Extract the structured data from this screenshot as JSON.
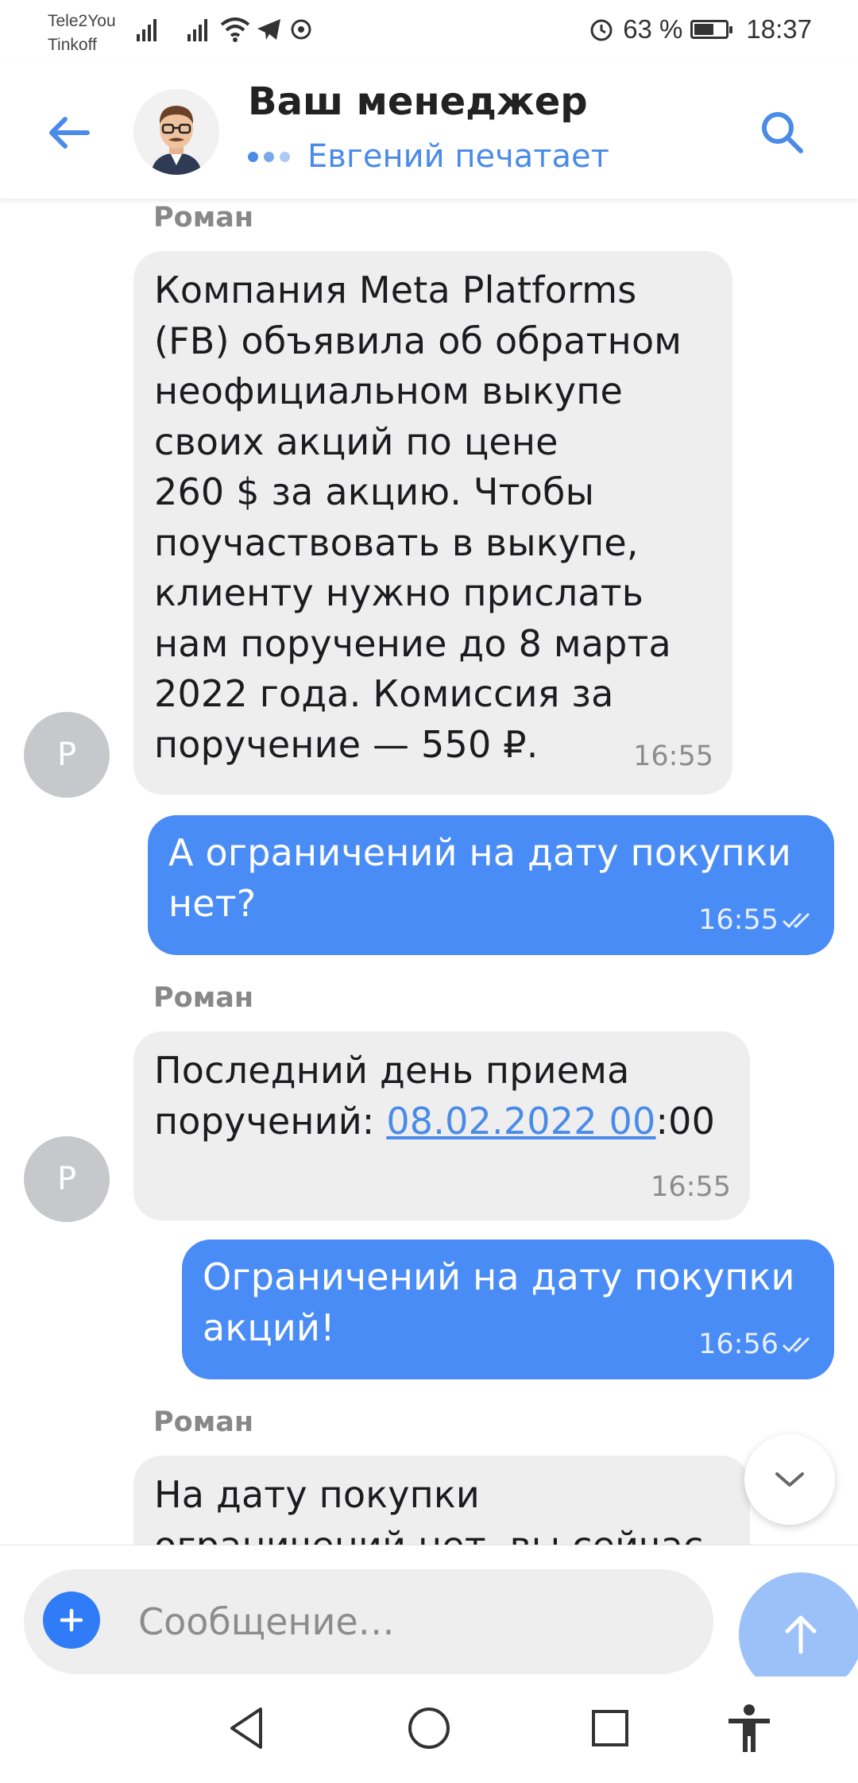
{
  "status_bar": {
    "carrier_1": "Tele2You",
    "carrier_2": "Tinkoff",
    "battery": "63 %",
    "battery_level": 0.63,
    "time": "18:37"
  },
  "header": {
    "title": "Ваш менеджер",
    "subtitle": "Евгений печатает",
    "back_icon": "arrow-left-icon",
    "search_icon": "search-icon"
  },
  "messages": [
    {
      "direction": "in",
      "sender": "Роман",
      "avatar": "Р",
      "text": "Компания Meta Platforms\n(FB) объявила об обратном\nнеофициальном выкупе\nсвоих акций по цене\n260 $ за акцию. Чтобы\nпоучаствовать в выкупе,\nклиенту нужно прислать\nнам поручение до 8 марта\n2022 года. Комиссия за\nпоручение — 550 ₽.",
      "time": "16:55"
    },
    {
      "direction": "out",
      "text": "А ограничений на дату покупки\nнет?",
      "time": "16:55",
      "status": "read"
    },
    {
      "direction": "in",
      "sender": "Роман",
      "avatar": "Р",
      "text_prefix": "Последний день приема\nпоручений: ",
      "link": "08.02.2022 00",
      "text_suffix": ":00",
      "time": "16:55"
    },
    {
      "direction": "out",
      "text": "Ограничений на дату покупки\nакций!",
      "time": "16:56",
      "status": "read"
    },
    {
      "direction": "in",
      "sender": "Роман",
      "text": "На дату покупки\nограничений нет, вы сейчас",
      "partial": true
    }
  ],
  "composer": {
    "placeholder": "Сообщение…"
  },
  "colors": {
    "accent": "#4a8be8",
    "outgoing_bubble": "#4a8cf6",
    "incoming_bubble": "#eeeeef",
    "send_button": "#9cc0f8"
  }
}
